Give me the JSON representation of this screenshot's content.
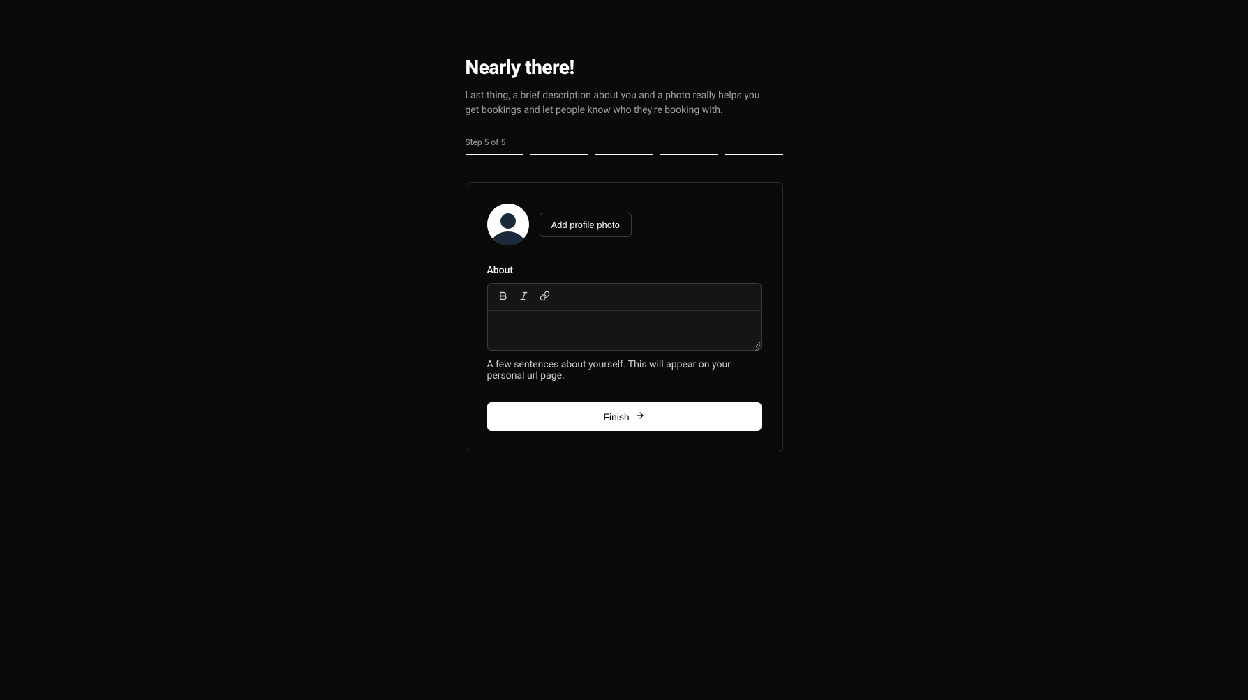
{
  "header": {
    "title": "Nearly there!",
    "subtitle": "Last thing, a brief description about you and a photo really helps you get bookings and let people know who they're booking with."
  },
  "progress": {
    "step_label": "Step 5 of 5",
    "total_steps": 5,
    "current_step": 5
  },
  "profile": {
    "add_photo_label": "Add profile photo"
  },
  "about": {
    "label": "About",
    "value": "",
    "helper_text": "A few sentences about yourself. This will appear on your personal url page."
  },
  "actions": {
    "finish_label": "Finish"
  }
}
